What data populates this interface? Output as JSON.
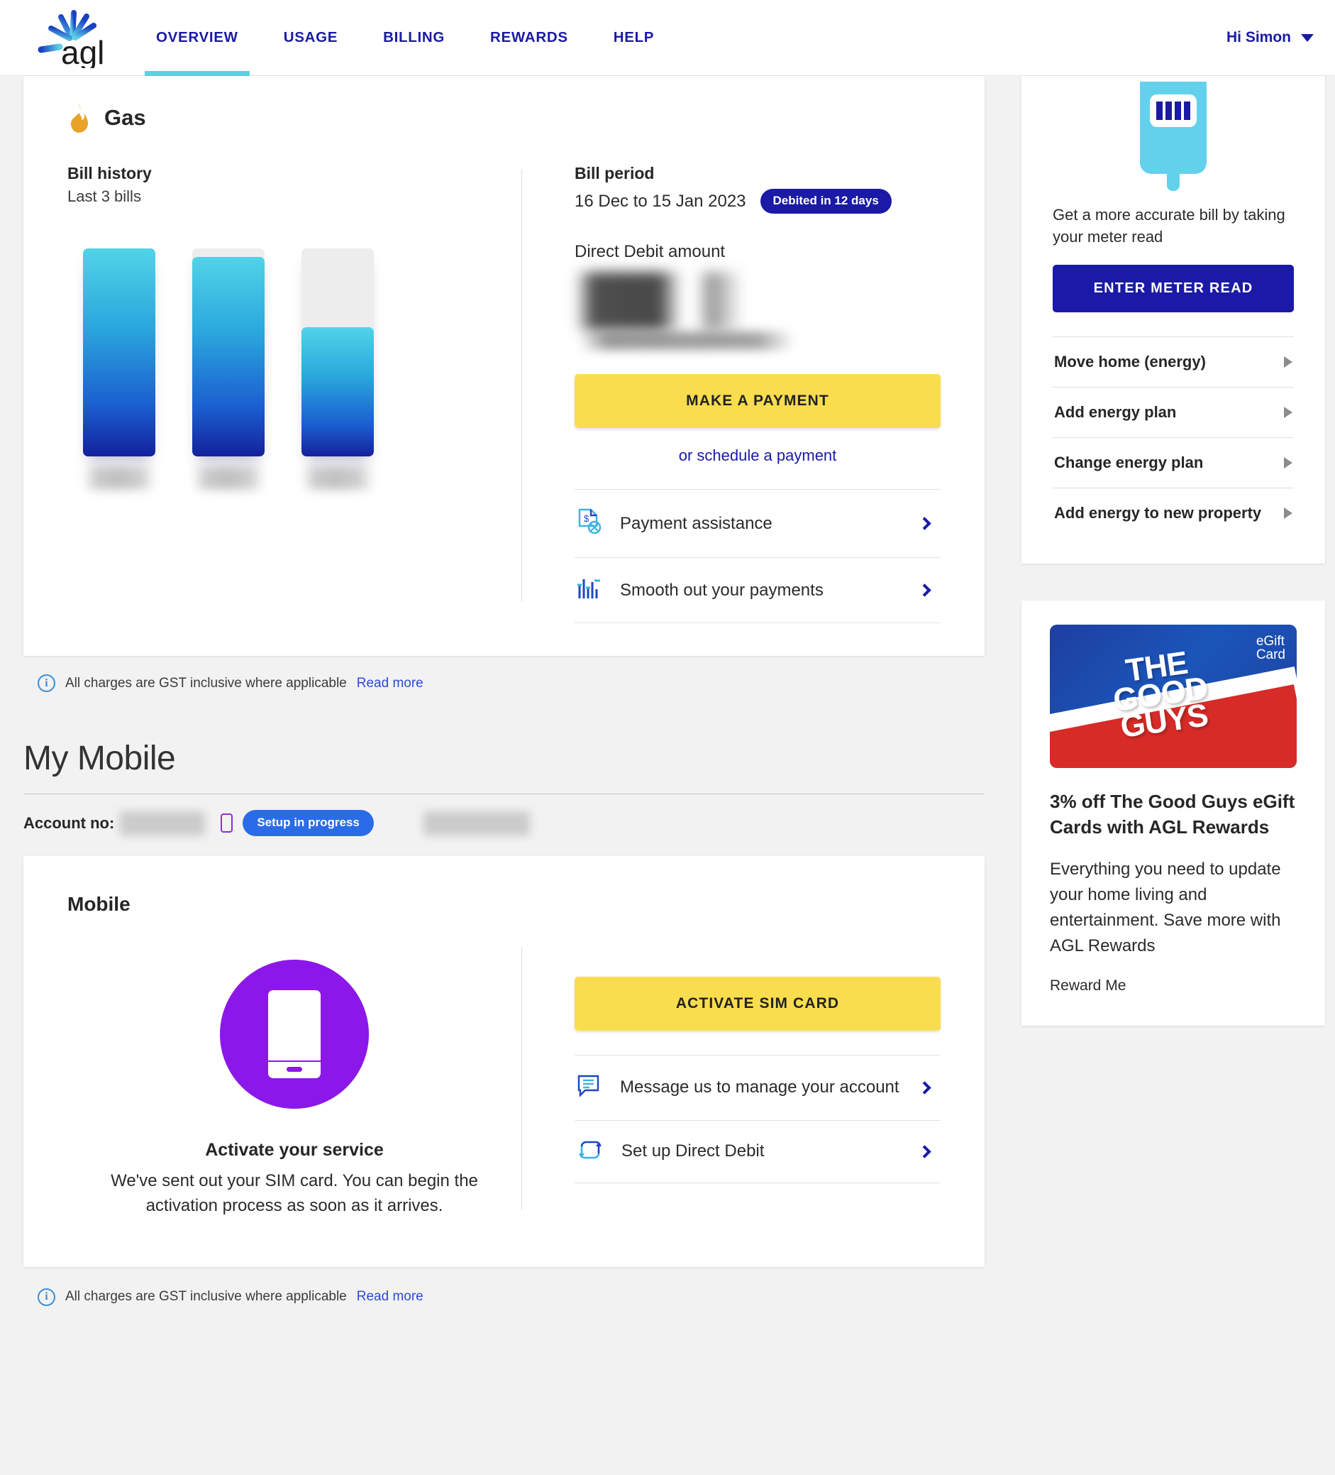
{
  "header": {
    "logo_alt": "agl",
    "nav": [
      {
        "label": "OVERVIEW",
        "active": true
      },
      {
        "label": "USAGE",
        "active": false
      },
      {
        "label": "BILLING",
        "active": false
      },
      {
        "label": "REWARDS",
        "active": false
      },
      {
        "label": "HELP",
        "active": false
      }
    ],
    "user_greeting": "Hi Simon"
  },
  "gas": {
    "service_title": "Gas",
    "bill_history": {
      "title": "Bill history",
      "subtitle": "Last 3 bills"
    },
    "bill_period": {
      "title": "Bill period",
      "dates": "16 Dec to 15 Jan 2023",
      "badge": "Debited in 12 days"
    },
    "direct_debit_label": "Direct Debit amount",
    "direct_debit_amount": "",
    "make_payment_label": "MAKE A PAYMENT",
    "schedule_link": "or schedule a payment",
    "links": [
      {
        "label": "Payment assistance",
        "icon": "document-dollar-icon"
      },
      {
        "label": "Smooth out your payments",
        "icon": "bar-levels-icon"
      }
    ]
  },
  "chart_data": {
    "type": "bar",
    "title": "Bill history",
    "subtitle": "Last 3 bills",
    "categories": [
      "",
      "",
      ""
    ],
    "values": [
      100,
      96,
      62
    ],
    "track_values": [
      100,
      100,
      100
    ],
    "xlabel": "",
    "ylabel": "",
    "ylim": [
      0,
      100
    ],
    "grid": false,
    "legend": false,
    "note": "Bar labels are redacted in the source screenshot; third bar shows a partially filled grey track."
  },
  "gst_note": {
    "text": "All charges are GST inclusive where applicable",
    "link": "Read more"
  },
  "mobile_section": {
    "heading": "My Mobile",
    "account_label": "Account no:",
    "account_number": "",
    "status_badge": "Setup in progress",
    "card": {
      "title": "Mobile",
      "activate_heading": "Activate your service",
      "activate_body": "We've sent out your SIM card. You can begin the activation process as soon as it arrives.",
      "activate_button": "ACTIVATE SIM CARD",
      "links": [
        {
          "label": "Message us to manage your account",
          "icon": "message-icon"
        },
        {
          "label": "Set up Direct Debit",
          "icon": "recurring-arrows-icon"
        }
      ]
    }
  },
  "sidebar": {
    "meter_card": {
      "text": "Get a more accurate bill by taking your meter read",
      "button": "ENTER METER READ",
      "links": [
        {
          "label": "Move home (energy)"
        },
        {
          "label": "Add energy plan"
        },
        {
          "label": "Change energy plan"
        },
        {
          "label": "Add energy to new property"
        }
      ]
    },
    "promo": {
      "card_brand_line1": "THE",
      "card_brand_line2": "GOOD",
      "card_brand_line3": "GUYS",
      "card_egift_line1": "eGift",
      "card_egift_line2": "Card",
      "heading": "3% off The Good Guys eGift Cards with AGL Rewards",
      "body": "Everything you need to update your home living and entertainment. Save more with AGL Rewards",
      "cta": "Reward Me"
    }
  },
  "colors": {
    "brand_blue": "#1a1aa6",
    "accent_cyan": "#5ecfe4",
    "yellow_cta": "#f9dd4e",
    "badge_blue": "#2a6ce8",
    "gas_flame": "#e8a327",
    "mobile_purple": "#8b18e8"
  }
}
